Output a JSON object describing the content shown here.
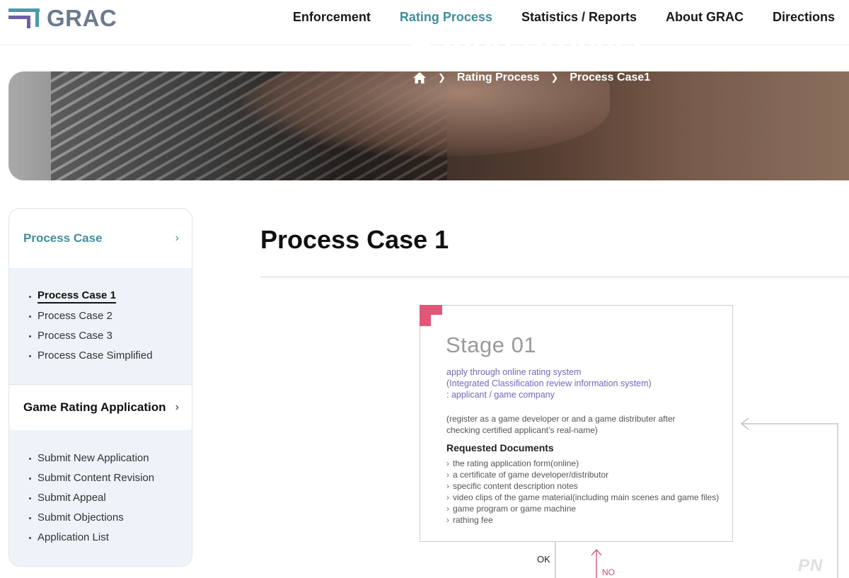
{
  "header": {
    "logo_text": "GRAC",
    "nav": [
      {
        "label": "Enforcement",
        "active": false
      },
      {
        "label": "Rating Process",
        "active": true
      },
      {
        "label": "Statistics / Reports",
        "active": false
      },
      {
        "label": "About GRAC",
        "active": false
      },
      {
        "label": "Directions",
        "active": false
      }
    ]
  },
  "banner": {
    "title": "Rating Process",
    "breadcrumb": [
      "Rating Process",
      "Process Case1"
    ],
    "home_icon": "home-icon"
  },
  "sidebar": {
    "sections": [
      {
        "label": "Process Case",
        "items": [
          "Process Case 1",
          "Process Case 2",
          "Process Case 3",
          "Process Case Simplified"
        ],
        "current": "Process Case 1"
      },
      {
        "label": "Game Rating Application",
        "items": [
          "Submit New Application",
          "Submit Content Revision",
          "Submit Appeal",
          "Submit Objections",
          "Application List"
        ]
      }
    ]
  },
  "main": {
    "title": "Process Case 1",
    "stage": {
      "title": "Stage 01",
      "purple_lines": [
        "apply through online rating system",
        "(Integrated Classification review information system)",
        ": applicant / game company"
      ],
      "note_lines": [
        "(register as a game developer or and a game distributer after",
        "checking certified applicant’s real-name)"
      ],
      "requested_title": "Requested Documents",
      "requested_items": [
        "the rating application form(online)",
        "a certificate of game developer/distributor",
        "specific content description notes",
        "video clips of the game material(including main scenes and game files)",
        "game program or game machine",
        "rathing fee"
      ]
    },
    "flow": {
      "ok": "OK",
      "no": "NO"
    }
  },
  "watermark": "PN",
  "colors": {
    "accent": "#3f8f9c",
    "purple": "#7766b8",
    "pink": "#d04a6d",
    "sidebar_bg": "#eef3f9"
  }
}
